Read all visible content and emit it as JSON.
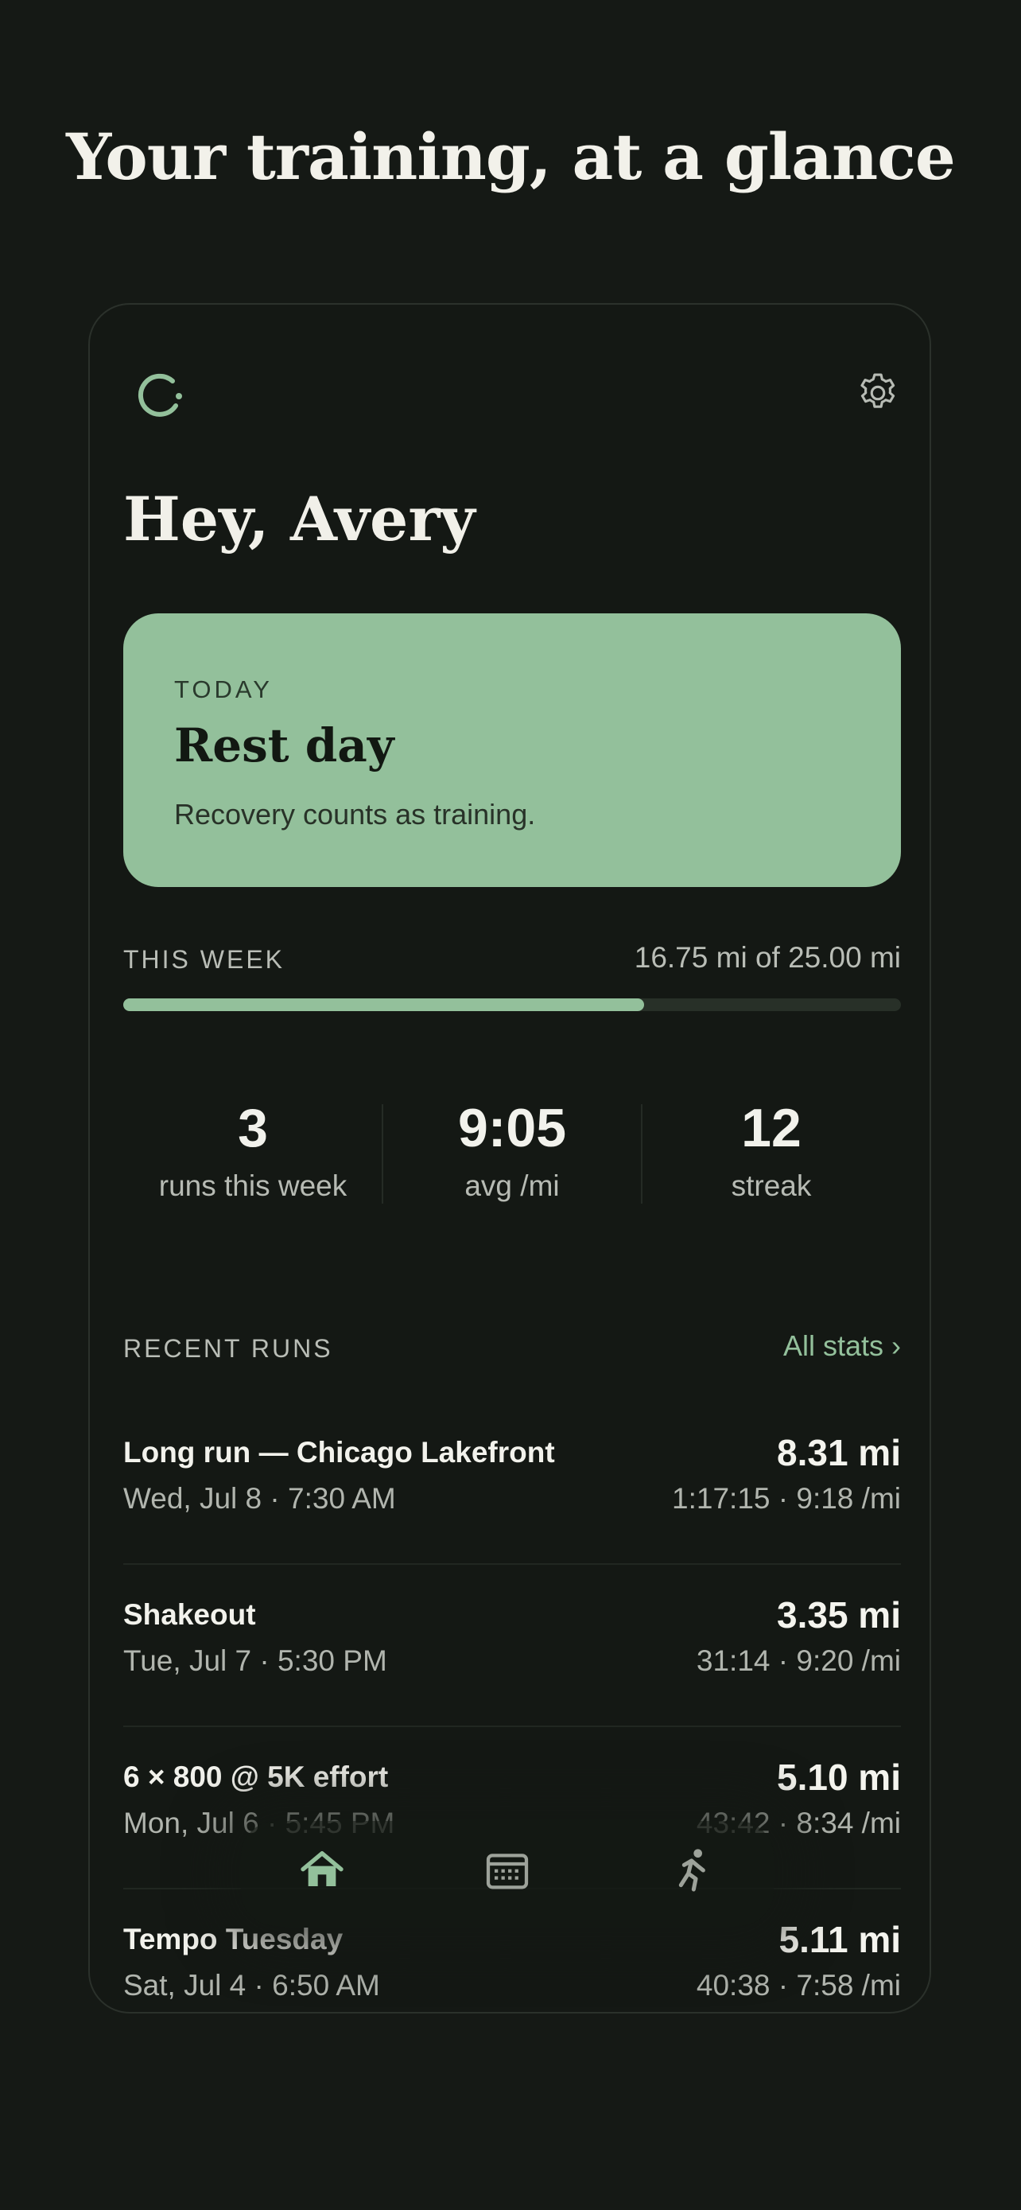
{
  "headline": "Your training, at a glance",
  "header": {
    "logo_icon": "ring-logo-icon",
    "settings_icon": "gear-icon"
  },
  "greeting": "Hey, Avery",
  "today": {
    "label": "TODAY",
    "title": "Rest day",
    "subtitle": "Recovery counts as training."
  },
  "week": {
    "label": "THIS WEEK",
    "value": "16.75 mi of 25.00 mi",
    "progress": 0.67
  },
  "stats": [
    {
      "value": "3",
      "label": "runs this week"
    },
    {
      "value": "9:05",
      "label": "avg /mi"
    },
    {
      "value": "12",
      "label": "streak"
    }
  ],
  "recent": {
    "label": "RECENT RUNS",
    "link": "All stats ›",
    "runs": [
      {
        "title": "Long run — Chicago Lakefront",
        "date": "Wed, Jul 8 · 7:30 AM",
        "distance": "8.31 mi",
        "pace": "1:17:15 · 9:18 /mi"
      },
      {
        "title": "Shakeout",
        "date": "Tue, Jul 7 · 5:30 PM",
        "distance": "3.35 mi",
        "pace": "31:14 · 9:20 /mi"
      },
      {
        "title": "6 × 800 @ 5K effort",
        "date": "Mon, Jul 6 · 5:45 PM",
        "distance": "5.10 mi",
        "pace": "43:42 · 8:34 /mi"
      },
      {
        "title": "Tempo Tuesday",
        "date": "Sat, Jul 4 · 6:50 AM",
        "distance": "5.11 mi",
        "pace": "40:38 · 7:58 /mi"
      }
    ]
  },
  "nav": [
    {
      "icon": "home-icon",
      "active": true
    },
    {
      "icon": "calendar-icon",
      "active": false
    },
    {
      "icon": "runner-icon",
      "active": false
    }
  ],
  "colors": {
    "background": "#151915",
    "accent": "#93C09B",
    "text": "#F2F2EC",
    "muted": "#B1B5AE"
  }
}
